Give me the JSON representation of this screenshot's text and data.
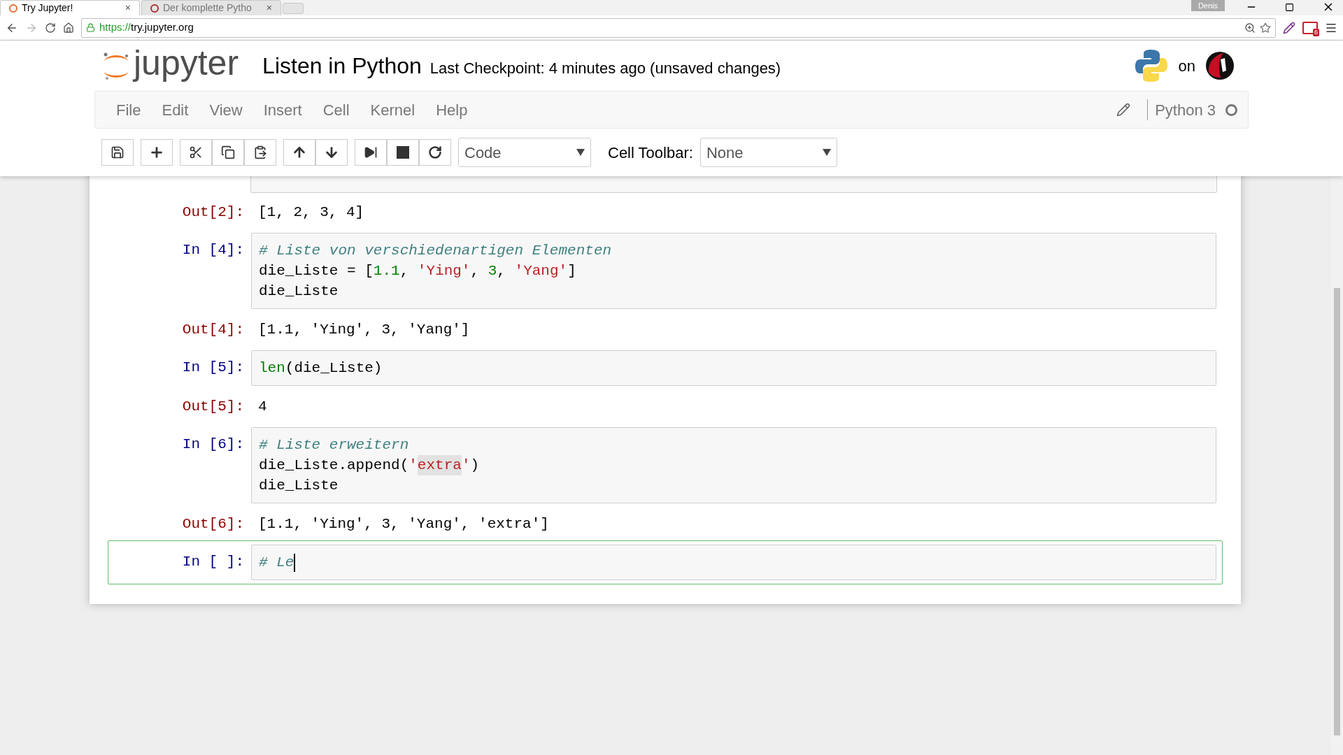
{
  "browser": {
    "tabs": [
      {
        "title": "Try Jupyter!",
        "selected": true,
        "close": "×"
      },
      {
        "title": "Der komplette Pytho",
        "selected": false,
        "close": "×"
      }
    ],
    "url_scheme": "https://",
    "url_rest": "try.jupyter.org",
    "profile": "Denis",
    "mail_badge": "6"
  },
  "header": {
    "logo_text": "jupyter",
    "notebook_name": "Listen in Python",
    "checkpoint": "Last Checkpoint: 4 minutes ago (unsaved changes)",
    "on_text": "on"
  },
  "menu": [
    "File",
    "Edit",
    "View",
    "Insert",
    "Cell",
    "Kernel",
    "Help"
  ],
  "kernel": {
    "name": "Python 3",
    "busy": false
  },
  "toolbar": {
    "cell_type": "Code",
    "cell_toolbar_label": "Cell Toolbar:",
    "cell_toolbar_value": "None"
  },
  "cells": [
    {
      "kind": "clipped_input"
    },
    {
      "kind": "output",
      "prompt": "Out[2]:",
      "text": "[1, 2, 3, 4]"
    },
    {
      "kind": "input",
      "prompt": "In [4]:",
      "selected": false,
      "lines": [
        [
          {
            "t": "# Liste von verschiedenartigen Elementen",
            "kind": "comment",
            "marked": false
          }
        ],
        [
          {
            "t": "die_Liste = [",
            "kind": "plain",
            "marked": false
          },
          {
            "t": "1.1",
            "kind": "number",
            "marked": false
          },
          {
            "t": ", ",
            "kind": "plain",
            "marked": false
          },
          {
            "t": "'Ying'",
            "kind": "string",
            "marked": false
          },
          {
            "t": ", ",
            "kind": "plain",
            "marked": false
          },
          {
            "t": "3",
            "kind": "number",
            "marked": false
          },
          {
            "t": ", ",
            "kind": "plain",
            "marked": false
          },
          {
            "t": "'Yang'",
            "kind": "string",
            "marked": false
          },
          {
            "t": "]",
            "kind": "plain",
            "marked": false
          }
        ],
        [
          {
            "t": "die_Liste",
            "kind": "plain",
            "marked": false
          }
        ]
      ]
    },
    {
      "kind": "output",
      "prompt": "Out[4]:",
      "text": "[1.1, 'Ying', 3, 'Yang']"
    },
    {
      "kind": "input",
      "prompt": "In [5]:",
      "selected": false,
      "lines": [
        [
          {
            "t": "len",
            "kind": "builtin",
            "marked": false
          },
          {
            "t": "(die_Liste)",
            "kind": "plain",
            "marked": false
          }
        ]
      ]
    },
    {
      "kind": "output",
      "prompt": "Out[5]:",
      "text": "4"
    },
    {
      "kind": "input",
      "prompt": "In [6]:",
      "selected": false,
      "lines": [
        [
          {
            "t": "# Liste erweitern",
            "kind": "comment",
            "marked": false
          }
        ],
        [
          {
            "t": "die_Liste.append(",
            "kind": "plain",
            "marked": false
          },
          {
            "t": "'",
            "kind": "string",
            "marked": false
          },
          {
            "t": "extra",
            "kind": "string",
            "marked": true
          },
          {
            "t": "'",
            "kind": "string",
            "marked": false
          },
          {
            "t": ")",
            "kind": "plain",
            "marked": false
          }
        ],
        [
          {
            "t": "die_Liste",
            "kind": "plain",
            "marked": false
          }
        ]
      ]
    },
    {
      "kind": "output",
      "prompt": "Out[6]:",
      "text": "[1.1, 'Ying', 3, 'Yang', 'extra']"
    },
    {
      "kind": "input",
      "prompt": "In [ ]:",
      "selected": true,
      "lines": [
        [
          {
            "t": "# Le",
            "kind": "comment",
            "marked": false
          }
        ]
      ]
    }
  ]
}
